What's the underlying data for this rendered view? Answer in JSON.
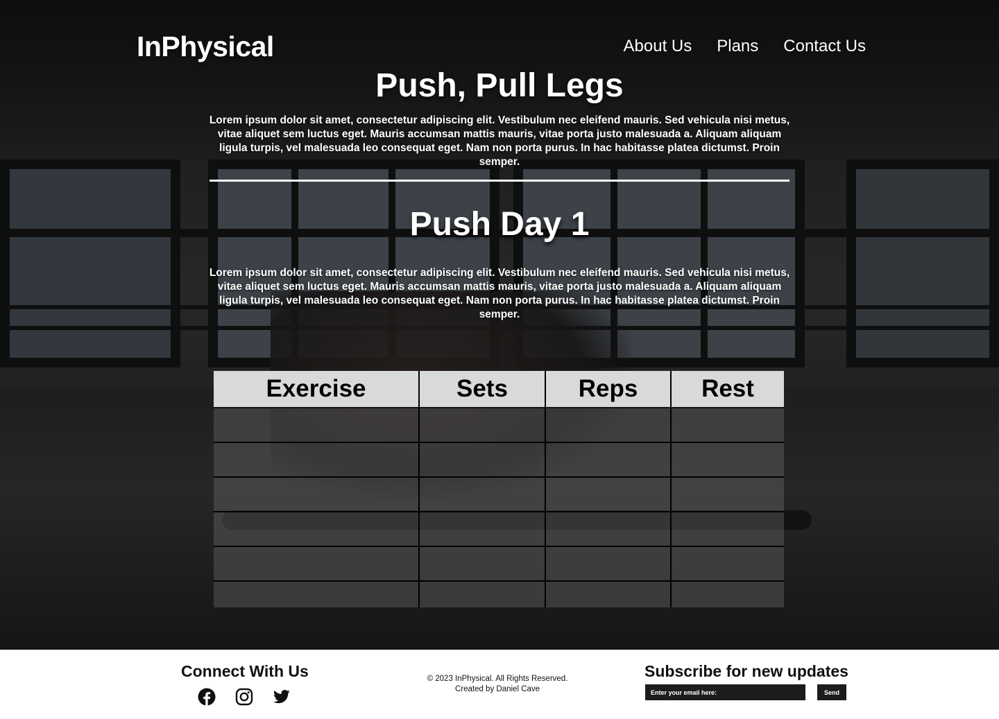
{
  "header": {
    "brand": "InPhysical",
    "nav": [
      {
        "label": "About Us"
      },
      {
        "label": "Plans"
      },
      {
        "label": "Contact Us"
      }
    ]
  },
  "intro": {
    "title": "Push, Pull Legs",
    "body": "Lorem ipsum dolor sit amet, consectetur adipiscing elit. Vestibulum nec eleifend mauris. Sed vehicula nisi metus, vitae aliquet sem luctus eget. Mauris accumsan mattis mauris, vitae porta justo malesuada a. Aliquam aliquam ligula turpis, vel malesuada leo consequat eget. Nam non porta purus. In hac habitasse platea dictumst. Proin semper."
  },
  "section": {
    "title": "Push Day 1",
    "body": "Lorem ipsum dolor sit amet, consectetur adipiscing elit. Vestibulum nec eleifend mauris. Sed vehicula nisi metus, vitae aliquet sem luctus eget. Mauris accumsan mattis mauris, vitae porta justo malesuada a. Aliquam aliquam ligula turpis, vel malesuada leo consequat eget. Nam non porta purus. In hac habitasse platea dictumst. Proin semper."
  },
  "table": {
    "columns": [
      "Exercise",
      "Sets",
      "Reps",
      "Rest"
    ],
    "rows": [
      [
        "",
        "",
        "",
        ""
      ],
      [
        "",
        "",
        "",
        ""
      ],
      [
        "",
        "",
        "",
        ""
      ],
      [
        "",
        "",
        "",
        ""
      ],
      [
        "",
        "",
        "",
        ""
      ],
      [
        "",
        "",
        "",
        ""
      ]
    ]
  },
  "footer": {
    "connect_title": "Connect With Us",
    "social_icons": [
      "facebook-icon",
      "instagram-icon",
      "twitter-icon"
    ],
    "copyright": "© 2023 InPhysical. All Rights Reserved.",
    "credit": "Created by Daniel Cave",
    "subscribe_title": "Subscribe for new updates",
    "email_placeholder": "Enter your email here:",
    "send_label": "Send"
  }
}
